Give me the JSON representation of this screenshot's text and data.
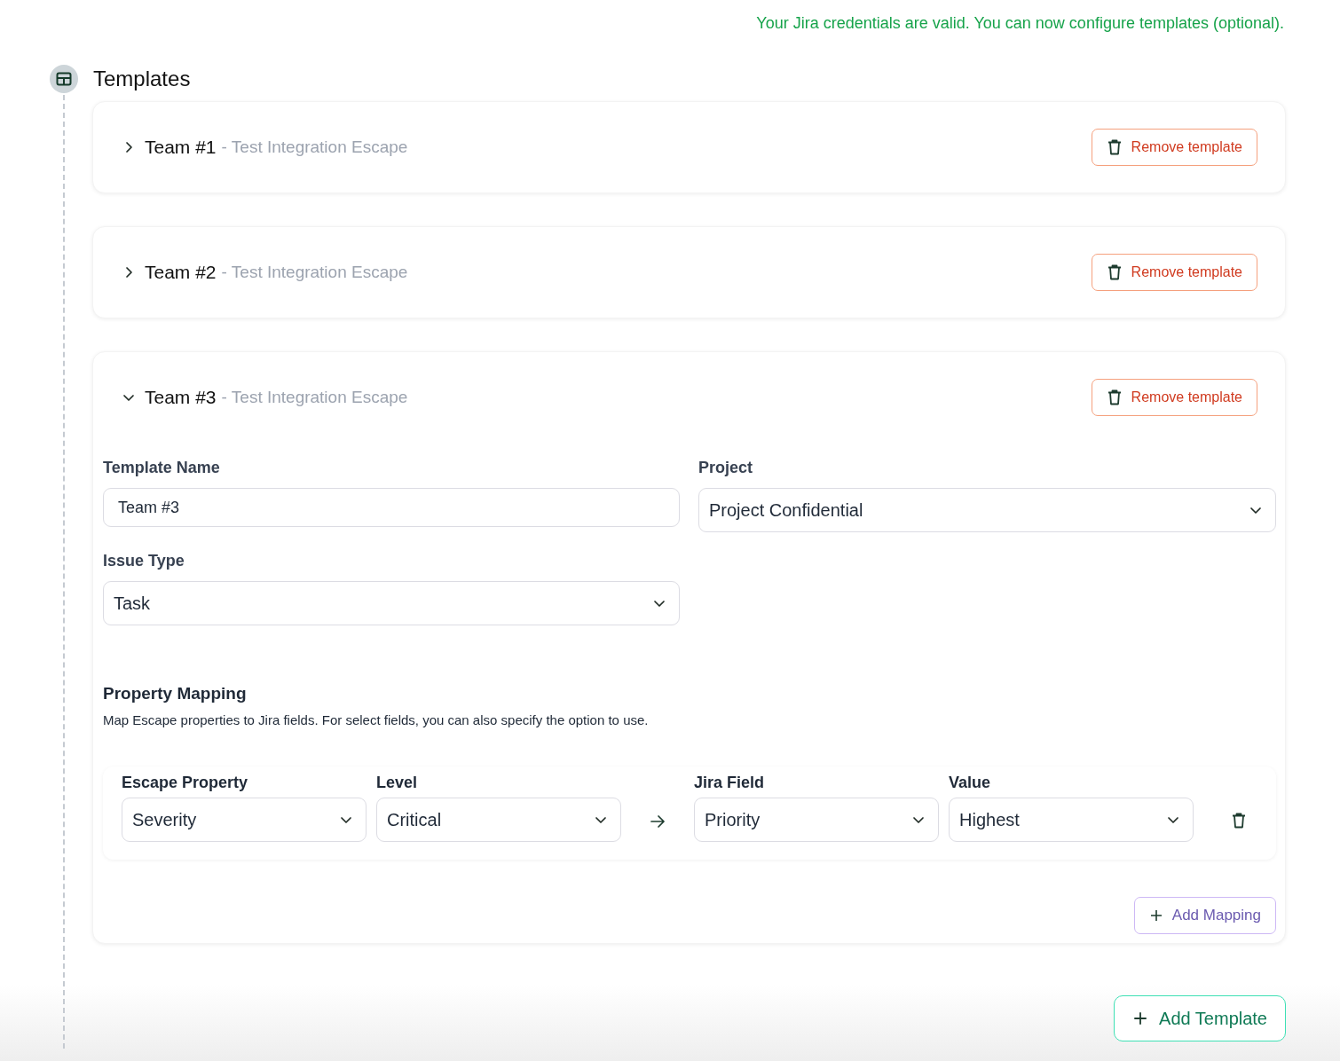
{
  "notice": "Your Jira credentials are valid. You can now configure templates (optional).",
  "section": {
    "title": "Templates"
  },
  "templates": [
    {
      "name": "Team #1",
      "subtitle": "- Test Integration Escape",
      "expanded": false,
      "remove_label": "Remove template"
    },
    {
      "name": "Team #2",
      "subtitle": "- Test Integration Escape",
      "expanded": false,
      "remove_label": "Remove template"
    },
    {
      "name": "Team #3",
      "subtitle": "- Test Integration Escape",
      "expanded": true,
      "remove_label": "Remove template",
      "form": {
        "template_name": {
          "label": "Template Name",
          "value": "Team #3"
        },
        "project": {
          "label": "Project",
          "value": "Project Confidential"
        },
        "issue_type": {
          "label": "Issue Type",
          "value": "Task"
        },
        "property_mapping": {
          "title": "Property Mapping",
          "description": "Map Escape properties to Jira fields. For select fields, you can also specify the option to use.",
          "columns": [
            "Escape Property",
            "Level",
            "Jira Field",
            "Value"
          ],
          "rows": [
            {
              "escape_property": "Severity",
              "level": "Critical",
              "jira_field": "Priority",
              "value": "Highest"
            }
          ],
          "add_label": "Add Mapping"
        }
      }
    }
  ],
  "add_template": "Add Template"
}
